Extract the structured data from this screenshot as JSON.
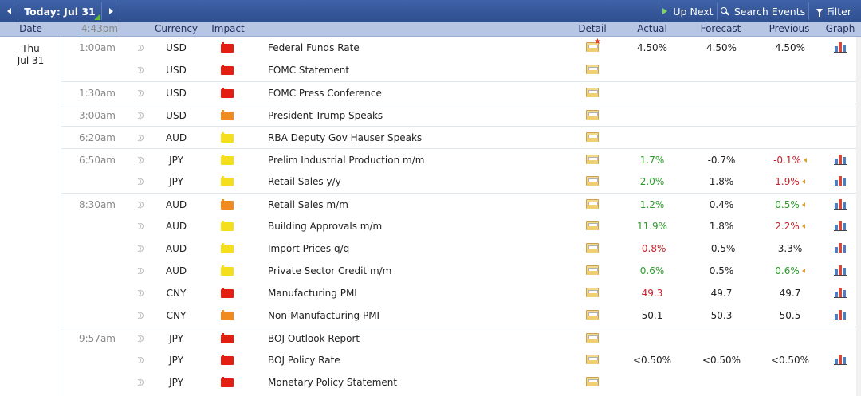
{
  "toolbar": {
    "today_label": "Today: Jul 31",
    "up_next_label": "Up Next",
    "search_label": "Search Events",
    "filter_label": "Filter"
  },
  "columns": {
    "date": "Date",
    "time": "4:43pm",
    "currency": "Currency",
    "impact": "Impact",
    "detail": "Detail",
    "actual": "Actual",
    "forecast": "Forecast",
    "previous": "Previous",
    "graph": "Graph"
  },
  "date": {
    "day": "Thu",
    "month_day": "Jul 31"
  },
  "rows": [
    {
      "time": "1:00am",
      "currency": "USD",
      "impact": "high",
      "event": "Federal Funds Rate",
      "detail_new": true,
      "actual": "4.50%",
      "actual_dir": "",
      "forecast": "4.50%",
      "previous": "4.50%",
      "previous_dir": "",
      "previous_revised": false,
      "graph": true,
      "band": true
    },
    {
      "time": "",
      "currency": "USD",
      "impact": "high",
      "event": "FOMC Statement",
      "detail_new": false,
      "actual": "",
      "actual_dir": "",
      "forecast": "",
      "previous": "",
      "previous_dir": "",
      "previous_revised": false,
      "graph": false,
      "band": false
    },
    {
      "time": "1:30am",
      "currency": "USD",
      "impact": "high",
      "event": "FOMC Press Conference",
      "detail_new": false,
      "actual": "",
      "actual_dir": "",
      "forecast": "",
      "previous": "",
      "previous_dir": "",
      "previous_revised": false,
      "graph": false,
      "band": true
    },
    {
      "time": "3:00am",
      "currency": "USD",
      "impact": "medium",
      "event": "President Trump Speaks",
      "detail_new": false,
      "actual": "",
      "actual_dir": "",
      "forecast": "",
      "previous": "",
      "previous_dir": "",
      "previous_revised": false,
      "graph": false,
      "band": true
    },
    {
      "time": "6:20am",
      "currency": "AUD",
      "impact": "low",
      "event": "RBA Deputy Gov Hauser Speaks",
      "detail_new": false,
      "actual": "",
      "actual_dir": "",
      "forecast": "",
      "previous": "",
      "previous_dir": "",
      "previous_revised": false,
      "graph": false,
      "band": true
    },
    {
      "time": "6:50am",
      "currency": "JPY",
      "impact": "low",
      "event": "Prelim Industrial Production m/m",
      "detail_new": false,
      "actual": "1.7%",
      "actual_dir": "better",
      "forecast": "-0.7%",
      "previous": "-0.1%",
      "previous_dir": "worse",
      "previous_revised": true,
      "graph": true,
      "band": true
    },
    {
      "time": "",
      "currency": "JPY",
      "impact": "low",
      "event": "Retail Sales y/y",
      "detail_new": false,
      "actual": "2.0%",
      "actual_dir": "better",
      "forecast": "1.8%",
      "previous": "1.9%",
      "previous_dir": "worse",
      "previous_revised": true,
      "graph": true,
      "band": false
    },
    {
      "time": "8:30am",
      "currency": "AUD",
      "impact": "medium",
      "event": "Retail Sales m/m",
      "detail_new": false,
      "actual": "1.2%",
      "actual_dir": "better",
      "forecast": "0.4%",
      "previous": "0.5%",
      "previous_dir": "better",
      "previous_revised": true,
      "graph": true,
      "band": true
    },
    {
      "time": "",
      "currency": "AUD",
      "impact": "low",
      "event": "Building Approvals m/m",
      "detail_new": false,
      "actual": "11.9%",
      "actual_dir": "better",
      "forecast": "1.8%",
      "previous": "2.2%",
      "previous_dir": "worse",
      "previous_revised": true,
      "graph": true,
      "band": false
    },
    {
      "time": "",
      "currency": "AUD",
      "impact": "low",
      "event": "Import Prices q/q",
      "detail_new": false,
      "actual": "-0.8%",
      "actual_dir": "worse",
      "forecast": "-0.5%",
      "previous": "3.3%",
      "previous_dir": "",
      "previous_revised": false,
      "graph": true,
      "band": false
    },
    {
      "time": "",
      "currency": "AUD",
      "impact": "low",
      "event": "Private Sector Credit m/m",
      "detail_new": false,
      "actual": "0.6%",
      "actual_dir": "better",
      "forecast": "0.5%",
      "previous": "0.6%",
      "previous_dir": "better",
      "previous_revised": true,
      "graph": true,
      "band": false
    },
    {
      "time": "",
      "currency": "CNY",
      "impact": "high",
      "event": "Manufacturing PMI",
      "detail_new": false,
      "actual": "49.3",
      "actual_dir": "worse",
      "forecast": "49.7",
      "previous": "49.7",
      "previous_dir": "",
      "previous_revised": false,
      "graph": true,
      "band": false
    },
    {
      "time": "",
      "currency": "CNY",
      "impact": "medium",
      "event": "Non-Manufacturing PMI",
      "detail_new": false,
      "actual": "50.1",
      "actual_dir": "",
      "forecast": "50.3",
      "previous": "50.5",
      "previous_dir": "",
      "previous_revised": false,
      "graph": true,
      "band": false
    },
    {
      "time": "9:57am",
      "currency": "JPY",
      "impact": "high",
      "event": "BOJ Outlook Report",
      "detail_new": false,
      "actual": "",
      "actual_dir": "",
      "forecast": "",
      "previous": "",
      "previous_dir": "",
      "previous_revised": false,
      "graph": false,
      "band": true
    },
    {
      "time": "",
      "currency": "JPY",
      "impact": "high",
      "event": "BOJ Policy Rate",
      "detail_new": false,
      "actual": "<0.50%",
      "actual_dir": "",
      "forecast": "<0.50%",
      "previous": "<0.50%",
      "previous_dir": "",
      "previous_revised": false,
      "graph": true,
      "band": false
    },
    {
      "time": "",
      "currency": "JPY",
      "impact": "high",
      "event": "Monetary Policy Statement",
      "detail_new": false,
      "actual": "",
      "actual_dir": "",
      "forecast": "",
      "previous": "",
      "previous_dir": "",
      "previous_revised": false,
      "graph": false,
      "band": false
    }
  ],
  "icons": {
    "prev": "chevron-left-icon",
    "next": "chevron-right-icon",
    "up_next": "play-icon",
    "search": "search-icon",
    "filter": "filter-icon"
  }
}
